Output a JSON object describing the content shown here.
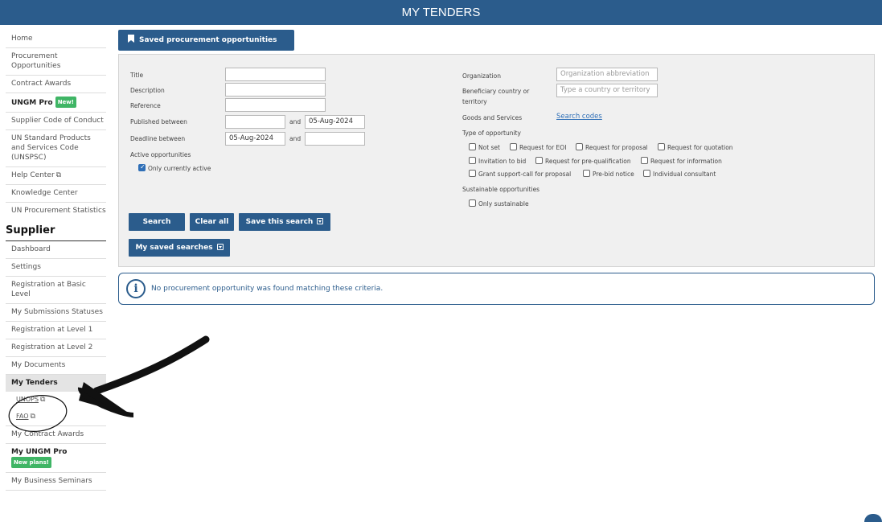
{
  "header": {
    "title": "MY TENDERS"
  },
  "sidebar": {
    "top_items": [
      {
        "label": "Home"
      },
      {
        "label": "Procurement Opportunities"
      },
      {
        "label": "Contract Awards"
      },
      {
        "label": "UNGM Pro",
        "badge": "New!"
      },
      {
        "label": "Supplier Code of Conduct"
      },
      {
        "label": "UN Standard Products and Services Code (UNSPSC)"
      },
      {
        "label": "Help Center"
      },
      {
        "label": "Knowledge Center"
      },
      {
        "label": "UN Procurement Statistics"
      }
    ],
    "section_title": "Supplier",
    "supplier_items": [
      {
        "label": "Dashboard"
      },
      {
        "label": "Settings"
      },
      {
        "label": "Registration at Basic Level"
      },
      {
        "label": "My Submissions Statuses"
      },
      {
        "label": "Registration at Level 1"
      },
      {
        "label": "Registration at Level 2"
      },
      {
        "label": "My Documents"
      },
      {
        "label": "My Tenders"
      },
      {
        "label": "UNOPS"
      },
      {
        "label": "FAO"
      },
      {
        "label": "My Contract Awards"
      },
      {
        "label": "My UNGM Pro",
        "badge": "New plans!"
      },
      {
        "label": "My Business Seminars"
      }
    ]
  },
  "saved_button": {
    "label": "Saved procurement opportunities"
  },
  "form": {
    "title_label": "Title",
    "description_label": "Description",
    "reference_label": "Reference",
    "published_label": "Published between",
    "published_and": "and",
    "published_to": "05-Aug-2024",
    "deadline_label": "Deadline between",
    "deadline_from": "05-Aug-2024",
    "deadline_and": "and",
    "active_label": "Active opportunities",
    "only_active": "Only currently active",
    "organization_label": "Organization",
    "organization_placeholder": "Organization abbreviation",
    "country_label_1": "Beneficiary country or",
    "country_label_2": "territory",
    "country_placeholder": "Type a country or territory",
    "goods_label": "Goods and Services",
    "search_codes": "Search codes",
    "type_label": "Type of opportunity",
    "types": [
      "Not set",
      "Request for EOI",
      "Request for proposal",
      "Request for quotation",
      "Invitation to bid",
      "Request for pre-qualification",
      "Request for information",
      "Grant support-call for proposal",
      "Pre-bid notice",
      "Individual consultant"
    ],
    "sustainable_label": "Sustainable opportunities",
    "only_sustainable": "Only sustainable"
  },
  "buttons": {
    "search": "Search",
    "clear_all": "Clear all",
    "save_search": "Save this search",
    "my_saved_searches": "My saved searches"
  },
  "info_message": "No procurement opportunity was found matching these criteria."
}
